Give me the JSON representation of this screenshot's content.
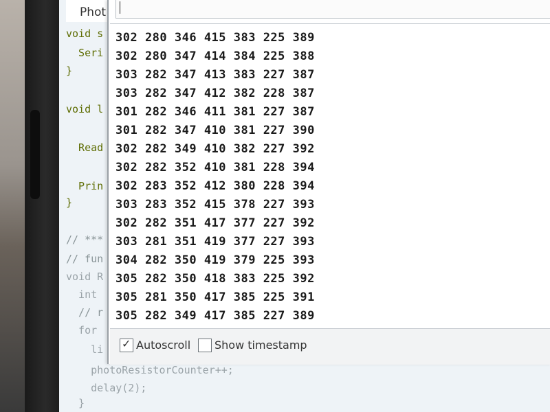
{
  "editor": {
    "tab_label": "Phot",
    "code_lines": [
      {
        "text": "void s",
        "cls": ""
      },
      {
        "text": "  Seri",
        "cls": ""
      },
      {
        "text": "}",
        "cls": ""
      },
      {
        "text": "void l",
        "cls": ""
      },
      {
        "text": "  Read",
        "cls": ""
      },
      {
        "text": "  Prin",
        "cls": ""
      },
      {
        "text": "}",
        "cls": ""
      },
      {
        "text": "// ***",
        "cls": "code-comment"
      },
      {
        "text": "// fun",
        "cls": "code-comment"
      },
      {
        "text": "void R",
        "cls": "code-dim"
      },
      {
        "text": "  int",
        "cls": "code-dim"
      },
      {
        "text": "  // r",
        "cls": "code-comment"
      },
      {
        "text": "  for",
        "cls": "code-dim"
      },
      {
        "text": "    li",
        "cls": "code-dim"
      },
      {
        "text": "    photoResistorCounter++;",
        "cls": "code-dim"
      },
      {
        "text": "    delay(2);",
        "cls": "code-dim"
      },
      {
        "text": "  }",
        "cls": "code-dim"
      }
    ]
  },
  "serial_monitor": {
    "input_value": "",
    "output_rows": [
      "302 280 346 415 383 225 389",
      "302 280 347 414 384 225 388",
      "303 282 347 413 383 227 387",
      "303 282 347 412 382 228 387",
      "301 282 346 411 381 227 387",
      "301 282 347 410 381 227 390",
      "302 282 349 410 382 227 392",
      "302 282 352 410 381 228 394",
      "302 283 352 412 380 228 394",
      "303 283 352 415 378 227 393",
      "302 282 351 417 377 227 392",
      "303 281 351 419 377 227 393",
      "304 282 350 419 379 225 393",
      "305 282 350 418 383 225 392",
      "305 281 350 417 385 225 391",
      "305 282 349 417 385 227 389"
    ],
    "autoscroll_label": "Autoscroll",
    "autoscroll_checked": true,
    "timestamp_label": "Show timestamp",
    "timestamp_checked": false,
    "check_mark": "✓"
  }
}
